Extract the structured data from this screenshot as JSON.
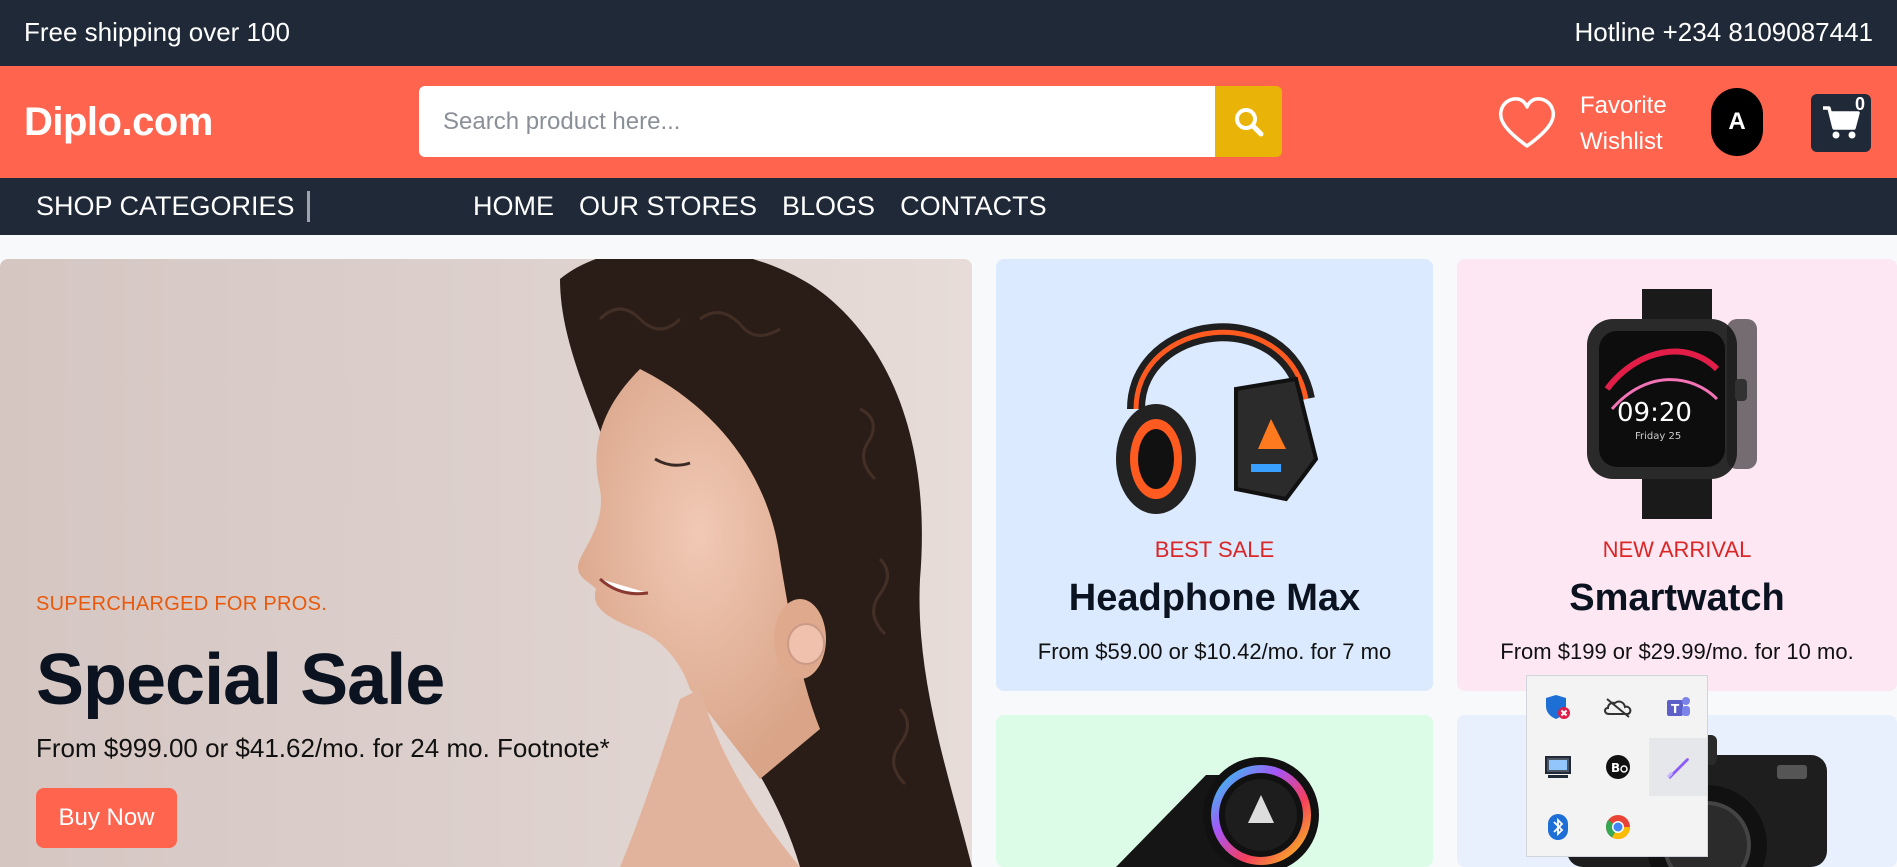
{
  "topbar": {
    "shipping_text": "Free shipping over 100",
    "hotline_text": "Hotline +234 8109087441"
  },
  "header": {
    "logo": "Diplo.com",
    "search_placeholder": "Search product here...",
    "favorite_label": "Favorite",
    "wishlist_label": "Wishlist",
    "avatar_letter": "A",
    "cart_count": "0"
  },
  "nav": {
    "categories_label": "SHOP CATEGORIES",
    "links": [
      "HOME",
      "OUR STORES",
      "BLOGS",
      "CONTACTS"
    ]
  },
  "hero": {
    "tag": "SUPERCHARGED FOR PROS.",
    "title": "Special Sale",
    "subtitle": "From $999.00 or $41.62/mo. for 24 mo. Footnote*",
    "button": "Buy Now"
  },
  "cards": [
    {
      "tag": "BEST SALE",
      "title": "Headphone Max",
      "price": "From $59.00 or $10.42/mo. for 7 mo",
      "bg": "#dbeafe"
    },
    {
      "tag": "NEW ARRIVAL",
      "title": "Smartwatch",
      "price": "From $199 or $29.99/mo. for 10 mo.",
      "bg": "#fce7f3"
    },
    {
      "bg": "#dcfce7"
    },
    {
      "bg": "#e8f0fe"
    }
  ],
  "smartwatch_screen": {
    "time": "09:20",
    "date": "Friday 25"
  },
  "tray_icons": [
    "defender-alert-icon",
    "onedrive-icon",
    "teams-icon",
    "display-icon",
    "beats-icon",
    "pen-icon",
    "bluetooth-icon",
    "chrome-icon"
  ],
  "colors": {
    "accent": "#ff644f",
    "dark": "#1f2937",
    "search_button": "#eab308"
  }
}
